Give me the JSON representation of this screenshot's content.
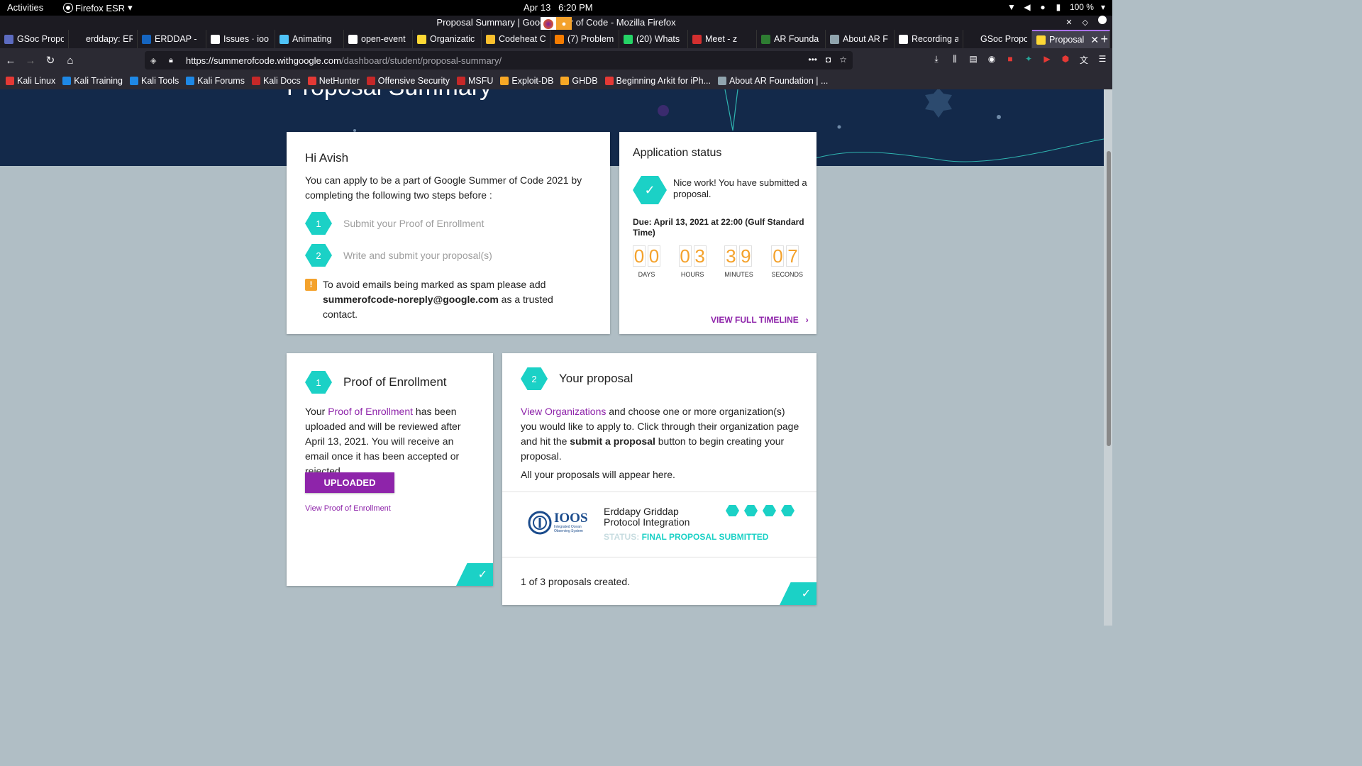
{
  "system": {
    "activities": "Activities",
    "app_name": "Firefox ESR",
    "date": "Apr 13",
    "time": "6:20 PM",
    "battery": "100 %"
  },
  "window": {
    "title": "Proposal Summary | Googl       er of Code - Mozilla Firefox"
  },
  "tabs": [
    {
      "label": "GSoc Propo",
      "color": "#5c6bc0"
    },
    {
      "label": "erddapy: ERD",
      "color": "#1c1b22"
    },
    {
      "label": "ERDDAP -",
      "color": "#1565c0"
    },
    {
      "label": "Issues · ioo",
      "color": "#fff"
    },
    {
      "label": "Animating",
      "color": "#4fc3f7"
    },
    {
      "label": "open-event",
      "color": "#fff"
    },
    {
      "label": "Organizatic",
      "color": "#fdd835"
    },
    {
      "label": "Codeheat C",
      "color": "#fbc02d"
    },
    {
      "label": "(7) Problem",
      "color": "#f57c00"
    },
    {
      "label": "(20) Whats",
      "color": "#25d366"
    },
    {
      "label": "Meet - z",
      "color": "#d32f2f"
    },
    {
      "label": "AR Founda",
      "color": "#2e7d32"
    },
    {
      "label": "About AR F",
      "color": "#90a4ae"
    },
    {
      "label": "Recording a",
      "color": "#fff"
    },
    {
      "label": "GSoc Proposal",
      "color": "#1c1b22"
    },
    {
      "label": "Proposal",
      "color": "#fdd835",
      "active": true
    }
  ],
  "url": {
    "host": "https://summerofcode.withgoogle.com",
    "path": "/dashboard/student/proposal-summary/"
  },
  "bookmarks": [
    {
      "label": "Kali Linux",
      "color": "#e53935"
    },
    {
      "label": "Kali Training",
      "color": "#1e88e5"
    },
    {
      "label": "Kali Tools",
      "color": "#1e88e5"
    },
    {
      "label": "Kali Forums",
      "color": "#1e88e5"
    },
    {
      "label": "Kali Docs",
      "color": "#c62828"
    },
    {
      "label": "NetHunter",
      "color": "#e53935"
    },
    {
      "label": "Offensive Security",
      "color": "#c62828"
    },
    {
      "label": "MSFU",
      "color": "#c62828"
    },
    {
      "label": "Exploit-DB",
      "color": "#f9a825"
    },
    {
      "label": "GHDB",
      "color": "#f9a825"
    },
    {
      "label": "Beginning Arkit for iPh...",
      "color": "#e53935"
    },
    {
      "label": "About AR Foundation | ...",
      "color": "#90a4ae"
    }
  ],
  "page": {
    "hero_title": "Proposal Summary"
  },
  "intro": {
    "greeting": "Hi Avish",
    "body": "You can apply to be a part of Google Summer of Code 2021 by completing the following two steps before :",
    "steps": [
      {
        "num": "1",
        "label": "Submit your Proof of Enrollment"
      },
      {
        "num": "2",
        "label": "Write and submit your proposal(s)"
      }
    ],
    "notice_before": "To avoid emails being marked as spam please add",
    "notice_email": "summerofcode-noreply@google.com",
    "notice_after": " as a trusted contact."
  },
  "status": {
    "title": "Application status",
    "message": "Nice work! You have submitted a proposal.",
    "due": "Due: April 13, 2021 at 22:00 (Gulf Standard Time)",
    "countdown": [
      {
        "digits": [
          "0",
          "0"
        ],
        "label": "DAYS"
      },
      {
        "digits": [
          "0",
          "3"
        ],
        "label": "HOURS"
      },
      {
        "digits": [
          "3",
          "9"
        ],
        "label": "MINUTES"
      },
      {
        "digits": [
          "0",
          "7"
        ],
        "label": "SECONDS"
      }
    ],
    "timeline_link": "VIEW FULL TIMELINE"
  },
  "enrollment": {
    "num": "1",
    "title": "Proof of Enrollment",
    "text_before": "Your ",
    "text_link": "Proof of Enrollment",
    "text_after": " has been uploaded and will be reviewed after April 13, 2021. You will receive an email once it has been accepted or rejected.",
    "button": "UPLOADED",
    "view_link": "View Proof of Enrollment"
  },
  "proposal": {
    "num": "2",
    "title": "Your proposal",
    "link": "View Organizations",
    "text1": " and choose one or more organization(s) you would like to apply to. Click through their organization page and hit the ",
    "bold": "submit a proposal",
    "text2": " button to begin creating your proposal.",
    "appear": "All your proposals will appear here.",
    "item": {
      "org_logo_text": "IOOS",
      "org_logo_sub": "Integrated Ocean Observing System",
      "title": "Erddapy Griddap Protocol Integration",
      "status_label": "STATUS:",
      "status_value": "FINAL PROPOSAL SUBMITTED"
    },
    "created": "1 of 3 proposals created."
  },
  "colors": {
    "teal": "#1bd1c6",
    "purple": "#8e24aa",
    "orange": "#f4a22c",
    "hero": "#13294a"
  }
}
